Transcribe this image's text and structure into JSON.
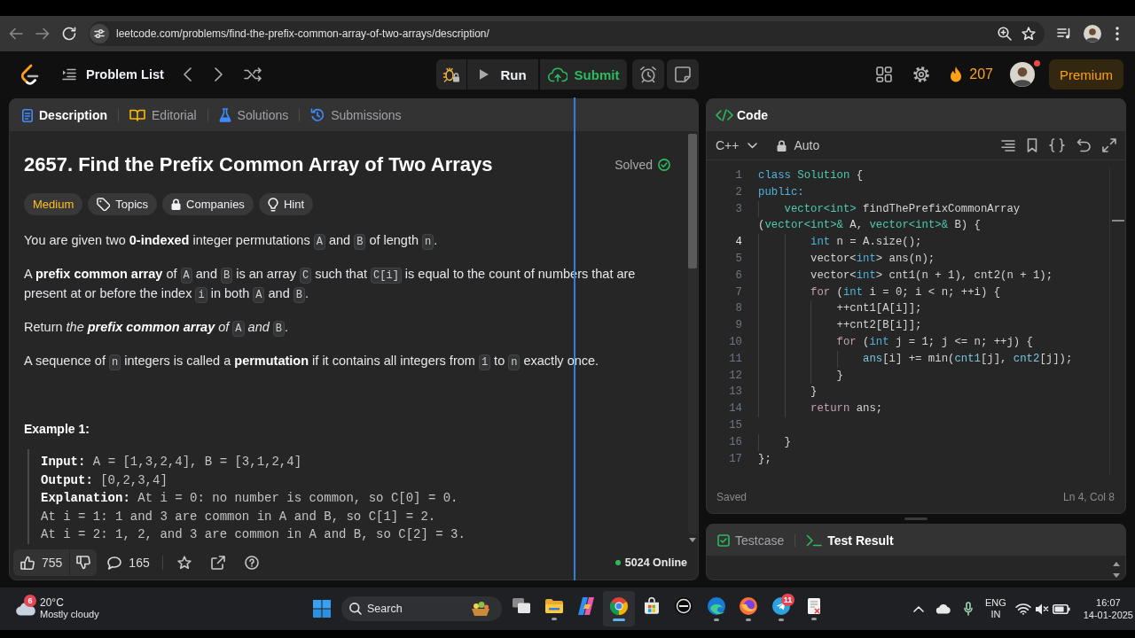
{
  "browser": {
    "url": "leetcode.com/problems/find-the-prefix-common-array-of-two-arrays/description/",
    "back_disabled": true,
    "forward_disabled": true
  },
  "navbar": {
    "problem_list": "Problem List",
    "run": "Run",
    "submit": "Submit",
    "streak": "207",
    "avatar_notification": true,
    "premium": "Premium"
  },
  "description": {
    "tabs": [
      {
        "label": "Description",
        "selected": true
      },
      {
        "label": "Editorial",
        "selected": false
      },
      {
        "label": "Solutions",
        "selected": false
      },
      {
        "label": "Submissions",
        "selected": false
      }
    ],
    "title": "2657. Find the Prefix Common Array of Two Arrays",
    "status": "Solved",
    "tags": [
      {
        "kind": "difficulty",
        "label": "Medium"
      },
      {
        "kind": "topics",
        "label": "Topics"
      },
      {
        "kind": "companies",
        "label": "Companies"
      },
      {
        "kind": "hint",
        "label": "Hint"
      }
    ],
    "paragraphs": [
      [
        {
          "kind": "text",
          "text": "You are given two **0-indexed** integer permutations "
        },
        {
          "kind": "code",
          "text": "A"
        },
        {
          "kind": "text",
          "text": " and "
        },
        {
          "kind": "code",
          "text": "B"
        },
        {
          "kind": "text",
          "text": " of length "
        },
        {
          "kind": "code",
          "text": "n"
        },
        {
          "kind": "text",
          "text": "."
        }
      ],
      [
        {
          "kind": "text",
          "text": "A **prefix common array** of "
        },
        {
          "kind": "code",
          "text": "A"
        },
        {
          "kind": "text",
          "text": " and "
        },
        {
          "kind": "code",
          "text": "B"
        },
        {
          "kind": "text",
          "text": " is an array "
        },
        {
          "kind": "code",
          "text": "C"
        },
        {
          "kind": "text",
          "text": " such that "
        },
        {
          "kind": "code",
          "text": "C[i]"
        },
        {
          "kind": "text",
          "text": " is equal to the count of numbers that are present at or before the index "
        },
        {
          "kind": "code",
          "text": "i"
        },
        {
          "kind": "text",
          "text": " in both "
        },
        {
          "kind": "code",
          "text": "A"
        },
        {
          "kind": "text",
          "text": " and "
        },
        {
          "kind": "code",
          "text": "B"
        },
        {
          "kind": "text",
          "text": "."
        }
      ],
      [
        {
          "kind": "text",
          "text": "Return "
        },
        {
          "kind": "italic",
          "text": "the **prefix common array** of "
        },
        {
          "kind": "code",
          "text": "A"
        },
        {
          "kind": "italic",
          "text": " and "
        },
        {
          "kind": "code",
          "text": "B"
        },
        {
          "kind": "text",
          "text": "."
        }
      ],
      [
        {
          "kind": "text",
          "text": "A sequence of "
        },
        {
          "kind": "code",
          "text": "n"
        },
        {
          "kind": "text",
          "text": " integers is called a **permutation** if it contains all integers from "
        },
        {
          "kind": "code",
          "text": "1"
        },
        {
          "kind": "text",
          "text": " to "
        },
        {
          "kind": "code",
          "text": "n"
        },
        {
          "kind": "text",
          "text": " exactly once."
        }
      ]
    ],
    "example": {
      "heading": "Example 1:",
      "lines": [
        "**Input:** A = [1,3,2,4], B = [3,1,2,4]",
        "**Output:** [0,2,3,4]",
        "**Explanation:** At i = 0: no number is common, so C[0] = 0.",
        "At i = 1: 1 and 3 are common in A and B, so C[1] = 2.",
        "At i = 2: 1, 2, and 3 are common in A and B, so C[2] = 3."
      ]
    },
    "footer": {
      "likes": "755",
      "comments": "165",
      "online": "5024 Online"
    }
  },
  "code_panel": {
    "title": "Code",
    "language": "C++",
    "mode": "Auto",
    "lines": [
      {
        "number": "1",
        "current": false,
        "tokens": [
          {
            "kind": "keyword",
            "text": "class"
          },
          {
            "kind": "type",
            "text": " Solution"
          },
          {
            "kind": "plain",
            "text": " {"
          }
        ]
      },
      {
        "number": "2",
        "current": false,
        "tokens": [
          {
            "kind": "keyword",
            "text": "public:"
          }
        ]
      },
      {
        "number": "3",
        "current": false,
        "tokens": [
          {
            "kind": "type",
            "text": "    vector<int>"
          },
          {
            "kind": "plain",
            "text": " findThePrefixCommonArray"
          }
        ]
      },
      {
        "tokens": [
          {
            "kind": "plain",
            "text": "("
          },
          {
            "kind": "type",
            "text": "vector<int>&"
          },
          {
            "kind": "plain",
            "text": " A, "
          },
          {
            "kind": "type",
            "text": "vector<int>&"
          },
          {
            "kind": "plain",
            "text": " B) {"
          }
        ]
      },
      {
        "number": "4",
        "current": true,
        "tokens": [
          {
            "kind": "keyword",
            "text": "        int"
          },
          {
            "kind": "plain",
            "text": " n = A.size();"
          }
        ]
      },
      {
        "number": "5",
        "current": false,
        "tokens": [
          {
            "kind": "plain",
            "text": "        vector<"
          },
          {
            "kind": "keyword",
            "text": "int"
          },
          {
            "kind": "plain",
            "text": "> ans(n);"
          }
        ]
      },
      {
        "number": "6",
        "current": false,
        "tokens": [
          {
            "kind": "plain",
            "text": "        vector<"
          },
          {
            "kind": "keyword",
            "text": "int"
          },
          {
            "kind": "plain",
            "text": "> cnt1(n + 1), cnt2(n + 1);"
          }
        ]
      },
      {
        "number": "7",
        "current": false,
        "tokens": [
          {
            "kind": "control",
            "text": "        for"
          },
          {
            "kind": "plain",
            "text": " ("
          },
          {
            "kind": "keyword",
            "text": "int"
          },
          {
            "kind": "plain",
            "text": " i = 0; i < n; ++i) {"
          }
        ]
      },
      {
        "number": "8",
        "current": false,
        "tokens": [
          {
            "kind": "plain",
            "text": "            ++cnt1[A[i]];"
          }
        ]
      },
      {
        "number": "9",
        "current": false,
        "tokens": [
          {
            "kind": "plain",
            "text": "            ++cnt2[B[i]];"
          }
        ]
      },
      {
        "number": "10",
        "current": false,
        "tokens": [
          {
            "kind": "control",
            "text": "            for"
          },
          {
            "kind": "plain",
            "text": " ("
          },
          {
            "kind": "keyword",
            "text": "int"
          },
          {
            "kind": "plain",
            "text": " j = 1; j <= n; ++j) {"
          }
        ]
      },
      {
        "number": "11",
        "current": false,
        "tokens": [
          {
            "kind": "variable",
            "text": "                ans"
          },
          {
            "kind": "plain",
            "text": "[i] += min("
          },
          {
            "kind": "variable",
            "text": "cnt1"
          },
          {
            "kind": "plain",
            "text": "[j], "
          },
          {
            "kind": "variable",
            "text": "cnt2"
          },
          {
            "kind": "plain",
            "text": "[j]);"
          }
        ]
      },
      {
        "number": "12",
        "current": false,
        "tokens": [
          {
            "kind": "plain",
            "text": "            }"
          }
        ]
      },
      {
        "number": "13",
        "current": false,
        "tokens": [
          {
            "kind": "plain",
            "text": "        }"
          }
        ]
      },
      {
        "number": "14",
        "current": false,
        "tokens": [
          {
            "kind": "control",
            "text": "        return"
          },
          {
            "kind": "plain",
            "text": " ans;"
          }
        ]
      },
      {
        "number": "15",
        "current": false
      },
      {
        "number": "16",
        "current": false,
        "tokens": [
          {
            "kind": "plain",
            "text": "    }"
          }
        ]
      },
      {
        "number": "17",
        "current": false,
        "tokens": [
          {
            "kind": "plain",
            "text": "};"
          }
        ]
      }
    ],
    "status": "Saved",
    "cursor": "Ln 4, Col 8"
  },
  "test_panel": {
    "tabs": [
      {
        "label": "Testcase",
        "selected": false
      },
      {
        "label": "Test Result",
        "selected": true
      }
    ]
  },
  "taskbar": {
    "weather": {
      "badge": "6",
      "temperature": "20°C",
      "condition": "Mostly cloudy"
    },
    "search": {
      "placeholder": "Search"
    },
    "apps": [
      {
        "kind": "task-view",
        "running": false,
        "selected": false
      },
      {
        "kind": "folder",
        "running": true,
        "selected": false
      },
      {
        "kind": "ribbon",
        "running": false,
        "selected": false
      },
      {
        "kind": "browser-circle",
        "running": true,
        "selected": true
      },
      {
        "kind": "bag",
        "running": false,
        "selected": false
      },
      {
        "kind": "circle-logo",
        "running": false,
        "selected": false
      },
      {
        "kind": "browser-swirl",
        "running": true,
        "selected": false
      },
      {
        "kind": "browser-orb",
        "running": true,
        "selected": false
      },
      {
        "kind": "paper-plane",
        "running": true,
        "selected": false,
        "badge": "11"
      },
      {
        "kind": "document",
        "running": true,
        "selected": false
      }
    ],
    "tray": {
      "volume_muted": true,
      "language": "ENG",
      "region": "IN",
      "time": "16:07",
      "date": "14-01-2025"
    }
  }
}
